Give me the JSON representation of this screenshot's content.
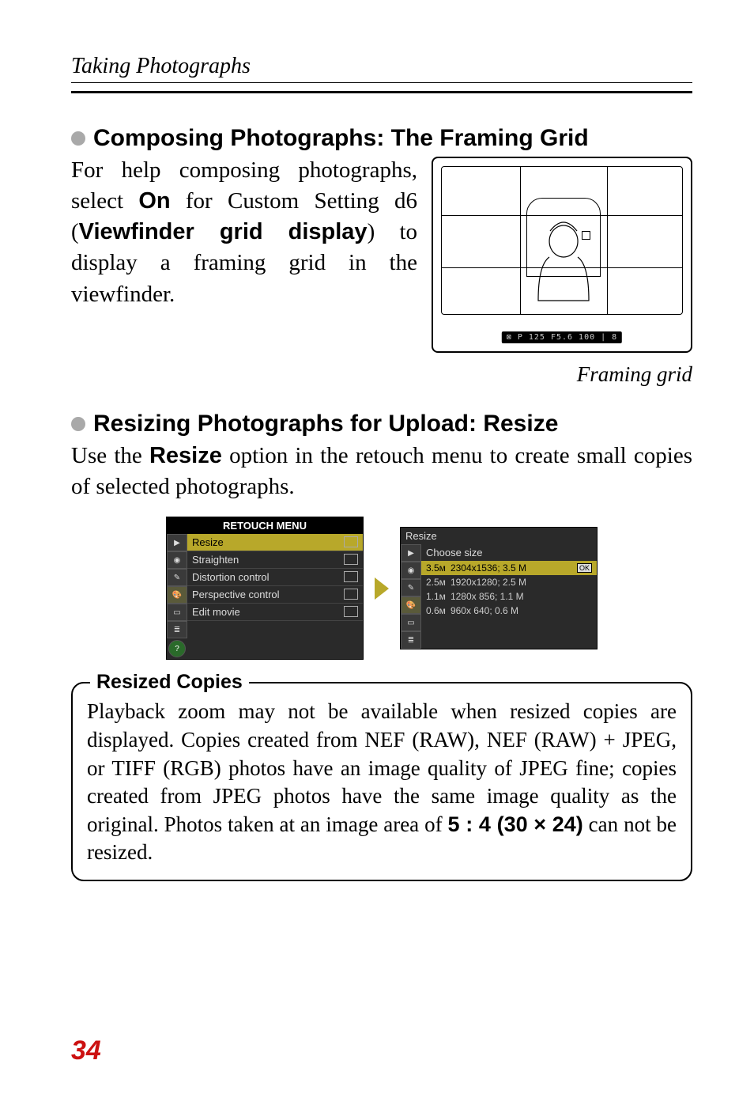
{
  "running_head": "Taking Photographs",
  "section1": {
    "title": "Composing Photographs: The Framing Grid",
    "body_pre": "For help composing photographs, select ",
    "body_on": "On",
    "body_mid1": " for Custom Setting d6 (",
    "body_setting": "Viewfinder grid display",
    "body_mid2": ") to display a framing grid in the viewfinder.",
    "info_bar": "⊠ P  125  F5.6   100  |  8",
    "caption": "Framing grid"
  },
  "section2": {
    "title": "Resizing Photographs for Upload: Resize",
    "body_pre": "Use the ",
    "body_bold": "Resize",
    "body_post": " option in the retouch menu to create small copies of selected photographs."
  },
  "menu_left": {
    "title": "RETOUCH MENU",
    "items": [
      {
        "label": "Resize",
        "selected": true
      },
      {
        "label": "Straighten",
        "selected": false
      },
      {
        "label": "Distortion control",
        "selected": false
      },
      {
        "label": "Perspective control",
        "selected": false
      },
      {
        "label": "Edit movie",
        "selected": false
      }
    ]
  },
  "menu_right": {
    "title": "Resize",
    "subtitle": "Choose size",
    "options": [
      {
        "size": "3.5ᴍ",
        "dims": "2304x1536; 3.5 M",
        "selected": true,
        "ok": "OK"
      },
      {
        "size": "2.5ᴍ",
        "dims": "1920x1280; 2.5 M",
        "selected": false
      },
      {
        "size": "1.1ᴍ",
        "dims": "1280x 856; 1.1 M",
        "selected": false
      },
      {
        "size": "0.6ᴍ",
        "dims": " 960x 640; 0.6 M",
        "selected": false
      }
    ]
  },
  "callout": {
    "title": "Resized Copies",
    "text_pre": "Playback zoom may not be available when resized copies are displayed. Copies created from NEF (RAW), NEF (RAW) + JPEG, or TIFF (RGB) photos have an image quality of JPEG fine; copies created from JPEG photos have the same image quality as the original. Photos taken at an image area of ",
    "text_bold": "5 : 4 (30 × 24)",
    "text_post": " can not be resized."
  },
  "page_number": "34"
}
